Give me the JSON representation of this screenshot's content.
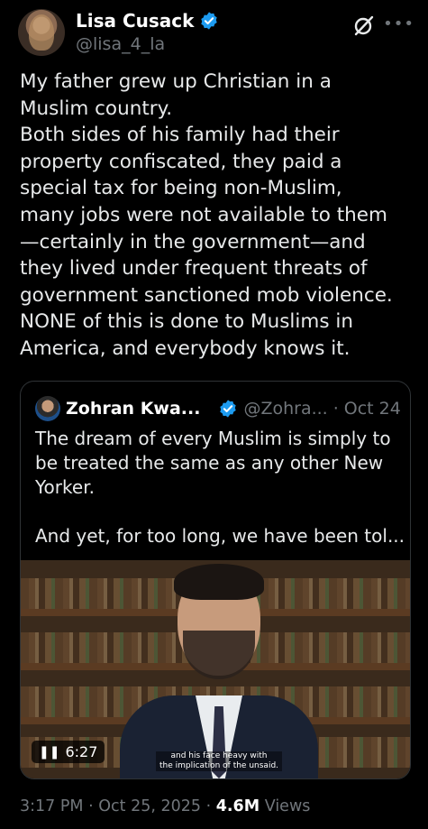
{
  "author": {
    "name": "Lisa Cusack",
    "handle": "@lisa_4_la"
  },
  "tweet": {
    "text": "My father grew up Christian in a\nMuslim country.\nBoth sides of his family had their\nproperty confiscated, they paid a\nspecial tax for being non-Muslim,\nmany jobs were not available to them\n—certainly in the government—and\nthey lived under frequent threats of\ngovernment sanctioned mob violence.\nNONE of this is done to Muslims in\nAmerica, and everybody knows it."
  },
  "quote": {
    "name": "Zohran Kwa...",
    "handle": "@Zohra...",
    "separator": "·",
    "date": "Oct 24",
    "text": "The dream of every Muslim is simply to\nbe treated the same as any other New\nYorker.\n\nAnd yet, for too long, we have been tol...",
    "video": {
      "duration": "6:27",
      "caption": "and his face heavy with\nthe implication of the unsaid."
    }
  },
  "meta": {
    "time": "3:17 PM",
    "separator": "·",
    "date": "Oct 25, 2025",
    "views_count": "4.6M",
    "views_label": "Views"
  },
  "colors": {
    "background": "#000000",
    "text": "#e7e9ea",
    "secondary": "#71767b",
    "verified": "#1d9bf0",
    "border": "#2f3336"
  },
  "icons": [
    "verified-badge-icon",
    "grok-icon",
    "more-icon",
    "pause-icon"
  ]
}
